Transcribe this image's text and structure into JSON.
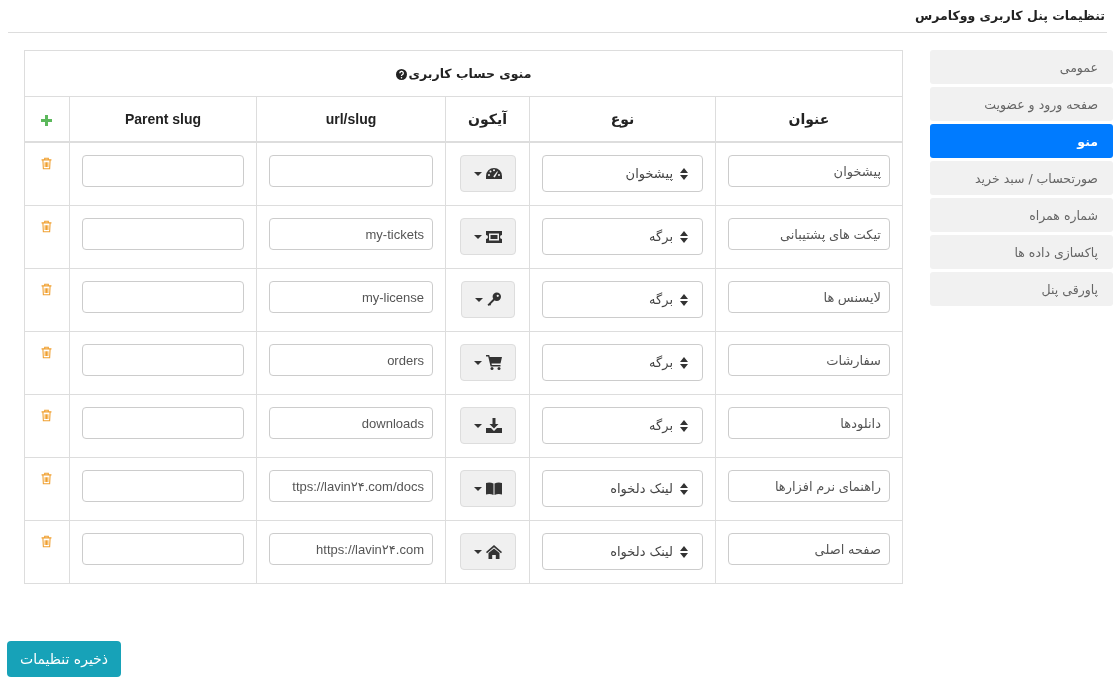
{
  "header": {
    "title": "تنظیمات پنل کاربری ووکامرس"
  },
  "sidebar": {
    "items": [
      {
        "label": "عمومی",
        "selected": false
      },
      {
        "label": "صفحه ورود و عضویت",
        "selected": false
      },
      {
        "label": "منو",
        "selected": true
      },
      {
        "label": "صورتحساب / سبد خرید",
        "selected": false
      },
      {
        "label": "شماره همراه",
        "selected": false
      },
      {
        "label": "پاکسازی داده ها",
        "selected": false
      },
      {
        "label": "پاورقی پنل",
        "selected": false
      }
    ]
  },
  "menu_table": {
    "title": "منوی حساب کاربری",
    "columns": [
      "عنوان",
      "نوع",
      "آیکون",
      "url/slug",
      "Parent slug"
    ],
    "rows": [
      {
        "title": "پیشخوان",
        "type": "پیشخوان",
        "icon": {
          "kind": "gauge"
        }
      },
      {
        "title": "تیکت های پشتیبانی",
        "type": "برگه",
        "icon": {
          "kind": "ticket"
        },
        "url": "my-tickets"
      },
      {
        "title": "لایسنس ها",
        "type": "برگه",
        "icon": {
          "kind": "key"
        },
        "url": "my-license"
      },
      {
        "title": "سفارشات",
        "type": "برگه",
        "icon": {
          "kind": "cart"
        },
        "url": "orders"
      },
      {
        "title": "دانلودها",
        "type": "برگه",
        "icon": {
          "kind": "download"
        },
        "url": "downloads"
      },
      {
        "title": "راهنمای نرم افزارها",
        "type": "لینک دلخواه",
        "icon": {
          "kind": "book"
        },
        "url": "ttps://lavin۲۴.com/docs"
      },
      {
        "title": "صفحه اصلی",
        "type": "لینک دلخواه",
        "icon": {
          "kind": "home"
        },
        "url": "https://lavin۲۴.com"
      }
    ]
  },
  "save_button": {
    "label": "ذخیره تنظیمات"
  }
}
